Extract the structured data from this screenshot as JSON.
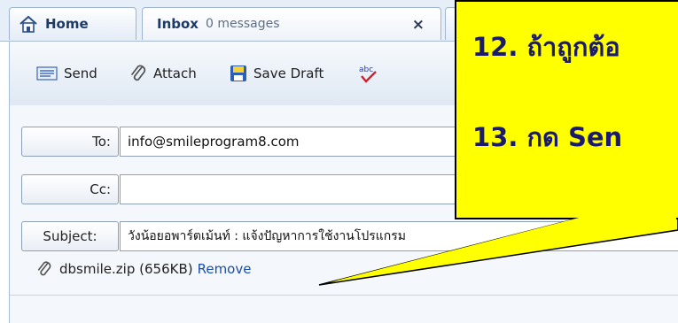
{
  "tabs": [
    {
      "label": "Home",
      "icon": "home-icon"
    },
    {
      "label": "Inbox",
      "sub": "0 messages",
      "close": "×"
    }
  ],
  "toolbar": {
    "send_label": "Send",
    "attach_label": "Attach",
    "save_draft_label": "Save Draft",
    "spell_label": "abc"
  },
  "form": {
    "to_label": "To:",
    "to_value": "info@smileprogram8.com",
    "cc_label": "Cc:",
    "cc_value": "",
    "subject_label": "Subject:",
    "subject_value": "วังน้อยอพาร์ตเม้นท์ : แจ้งปัญหาการใช้งานโปรแกรม",
    "attachment_name": "dbsmile.zip (656KB)",
    "remove_label": "Remove"
  },
  "callout": {
    "step12": "12. ถ้าถูกต้อ",
    "step13": "13. กด Sen",
    "fill": "#ffff00"
  }
}
